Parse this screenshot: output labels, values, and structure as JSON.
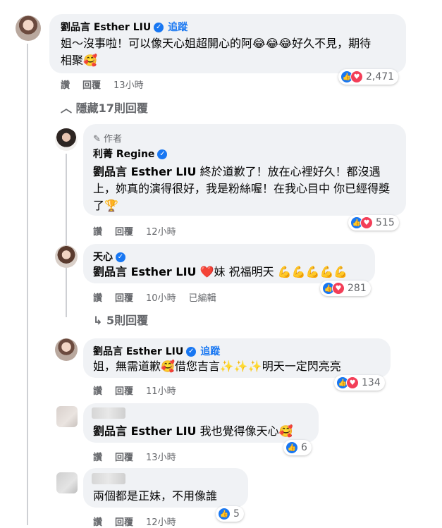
{
  "comments": [
    {
      "name": "劉品言 Esther LIU",
      "follow": "追蹤",
      "text": "姐～沒事啦！可以像天心姐超開心的阿😂😂😂好久不見，期待相聚🥰",
      "actions": {
        "like": "讚",
        "reply": "回覆",
        "time": "13小時"
      },
      "reactions": "2,471"
    },
    {
      "hide_label": "隱藏17則回覆"
    },
    {
      "author_badge": "作者",
      "name": "利菁 Regine",
      "mention": "劉品言 Esther LIU",
      "text": " 終於道歉了！放在心裡好久！都沒遇上，妳真的演得很好，我是粉絲喔！在我心目中 你已經得獎了🏆",
      "actions": {
        "like": "讚",
        "reply": "回覆",
        "time": "12小時"
      },
      "reactions": "515"
    },
    {
      "name": "天心",
      "mention": "劉品言 Esther LIU",
      "text": " ❤️妹 祝福明天 💪💪💪💪💪",
      "actions": {
        "like": "讚",
        "reply": "回覆",
        "time": "10小時",
        "edited": "已編輯"
      },
      "reactions": "281",
      "more_replies": "5則回覆"
    },
    {
      "name": "劉品言 Esther LIU",
      "follow": "追蹤",
      "text": "姐，無需道歉🥰借您吉言✨✨✨明天一定閃亮亮",
      "actions": {
        "like": "讚",
        "reply": "回覆",
        "time": "11小時"
      },
      "reactions": "134"
    },
    {
      "mention": "劉品言 Esther LIU",
      "text": " 我也覺得像天心🥰",
      "actions": {
        "like": "讚",
        "reply": "回覆",
        "time": "13小時"
      },
      "reactions": "6"
    },
    {
      "text": "兩個都是正妹，不用像誰",
      "actions": {
        "like": "讚",
        "reply": "回覆",
        "time": "12小時"
      },
      "reactions": "5"
    }
  ]
}
